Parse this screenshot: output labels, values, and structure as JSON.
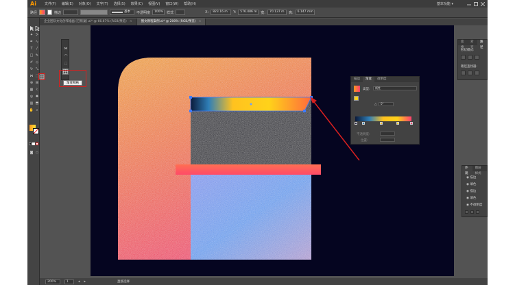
{
  "app": {
    "logo": "Ai",
    "menus": [
      "文件(F)",
      "编辑(E)",
      "对象(O)",
      "文字(T)",
      "选择(S)",
      "效果(C)",
      "视图(V)",
      "窗口(W)",
      "帮助(H)"
    ],
    "workspace": "基本功能 ▾"
  },
  "control_bar": {
    "path_label": "路径",
    "stroke_label": "描边",
    "stroke_style": "基本",
    "opacity_label": "不透明度",
    "opacity_value": "100%",
    "style_label": "样式",
    "x_label": "X:",
    "x_value": "823.16 m",
    "y_label": "Y:",
    "y_value": "576.486 m",
    "w_label": "宽:",
    "w_value": "70.137 m",
    "h_label": "高:",
    "h_value": "6.147 mm"
  },
  "tabs": [
    {
      "label": "企业团队文化创作插画 [已恢复].ai* @ 66.67% (RGB/预览)",
      "active": false
    },
    {
      "label": "图文教程案例.ai* @ 200% (RGB/预览)",
      "active": true
    }
  ],
  "tooltip": {
    "text": "渐变网格"
  },
  "gradient_panel": {
    "tabs": [
      "描边",
      "渐变",
      "透明度"
    ],
    "type_label": "类型:",
    "type_value": "线性",
    "angle_label": "△",
    "angle_value": "0°",
    "ratio_label": "",
    "opacity_label": "不透明度:",
    "location_label": "位置:"
  },
  "top_panel": {
    "tabs": [
      "变换",
      "对齐",
      "路径"
    ],
    "section1": "形状模式:",
    "section2": "路径查找器:"
  },
  "layers_panel": {
    "tabs": [
      "外观",
      "图层样式"
    ],
    "rows": [
      "描边",
      "填色",
      "描边",
      "填色",
      "不透明度"
    ]
  },
  "status_bar": {
    "zoom": "200%",
    "page": "1",
    "tool_name": "直接选择"
  },
  "colors": {
    "artboard_bg": "#050520",
    "orange": "#ffa51f",
    "pink": "#ff3f6e",
    "blue": "#5aa9ff",
    "yellow": "#ffd11a",
    "selection": "#3f7cff",
    "arrow_red": "#d9201f"
  }
}
